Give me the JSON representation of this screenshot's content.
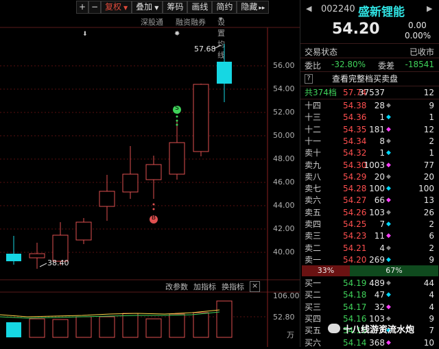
{
  "toolbar": {
    "plus": "+",
    "minus": "−",
    "restore_rights": "复权",
    "overlay": "叠加",
    "chips": "筹码",
    "draw": "画线",
    "simple": "简约",
    "hide": "隐藏",
    "more": "▸▸"
  },
  "subbar": {
    "connect": "深股通",
    "margin": "融资融券",
    "ma_setting": "设置均线"
  },
  "price_axis": [
    "56.00",
    "54.00",
    "52.00",
    "50.00",
    "48.00",
    "46.00",
    "44.00",
    "42.00",
    "40.00"
  ],
  "annotations": {
    "high": "57.68",
    "low": "38.40",
    "s_mark": "S",
    "b_mark": "B"
  },
  "indicator_bar": {
    "params": "改参数",
    "add": "加指标",
    "switch": "换指标",
    "close": "×"
  },
  "volume_axis": [
    "106.00",
    "52.80",
    "万"
  ],
  "stock": {
    "code": "002240",
    "name": "盛新锂能",
    "price": "54.20",
    "change": "0.00",
    "pct": "0.00%",
    "status_label": "交易状态",
    "status": "已收市",
    "ratio_label": "委比",
    "ratio": "-32.80%",
    "diff_label": "委差",
    "diff": "-18541",
    "help": "?",
    "full_book": "查看完整档买卖盘",
    "levels_label": "共374档",
    "levels_price": "57.74",
    "levels_vol": "37537",
    "levels_count": "12"
  },
  "asks": [
    {
      "label": "十四",
      "price": "54.38",
      "vol": "28",
      "count": "9"
    },
    {
      "label": "十三",
      "price": "54.36",
      "vol": "1",
      "count": "1"
    },
    {
      "label": "十二",
      "price": "54.35",
      "vol": "181",
      "count": "12"
    },
    {
      "label": "十一",
      "price": "54.34",
      "vol": "8",
      "count": "2"
    },
    {
      "label": "卖十",
      "price": "54.32",
      "vol": "1",
      "count": "1"
    },
    {
      "label": "卖九",
      "price": "54.30",
      "vol": "1003",
      "count": "77"
    },
    {
      "label": "卖八",
      "price": "54.29",
      "vol": "20",
      "count": "20"
    },
    {
      "label": "卖七",
      "price": "54.28",
      "vol": "100",
      "count": "100"
    },
    {
      "label": "卖六",
      "price": "54.27",
      "vol": "66",
      "count": "13"
    },
    {
      "label": "卖五",
      "price": "54.26",
      "vol": "103",
      "count": "26"
    },
    {
      "label": "卖四",
      "price": "54.25",
      "vol": "7",
      "count": "2"
    },
    {
      "label": "卖三",
      "price": "54.23",
      "vol": "11",
      "count": "6"
    },
    {
      "label": "卖二",
      "price": "54.21",
      "vol": "4",
      "count": "2"
    },
    {
      "label": "卖一",
      "price": "54.20",
      "vol": "269",
      "count": "9"
    }
  ],
  "balance": {
    "left": "33%",
    "right": "67%"
  },
  "bids": [
    {
      "label": "买一",
      "price": "54.19",
      "vol": "489",
      "count": "44"
    },
    {
      "label": "买二",
      "price": "54.18",
      "vol": "47",
      "count": "4"
    },
    {
      "label": "买三",
      "price": "54.17",
      "vol": "32",
      "count": "4"
    },
    {
      "label": "买四",
      "price": "54.16",
      "vol": "103",
      "count": "9"
    },
    {
      "label": "买五",
      "price": "54.15",
      "vol": "7",
      "count": "7"
    },
    {
      "label": "买六",
      "price": "54.14",
      "vol": "368",
      "count": "10"
    }
  ],
  "watermark": "十八线游资流水炮",
  "colors": {
    "up": "#ff4f4f",
    "down": "#00d8ff",
    "green": "#3fd35a",
    "yellow": "#ffd84a",
    "name": "#2fe0e0"
  }
}
